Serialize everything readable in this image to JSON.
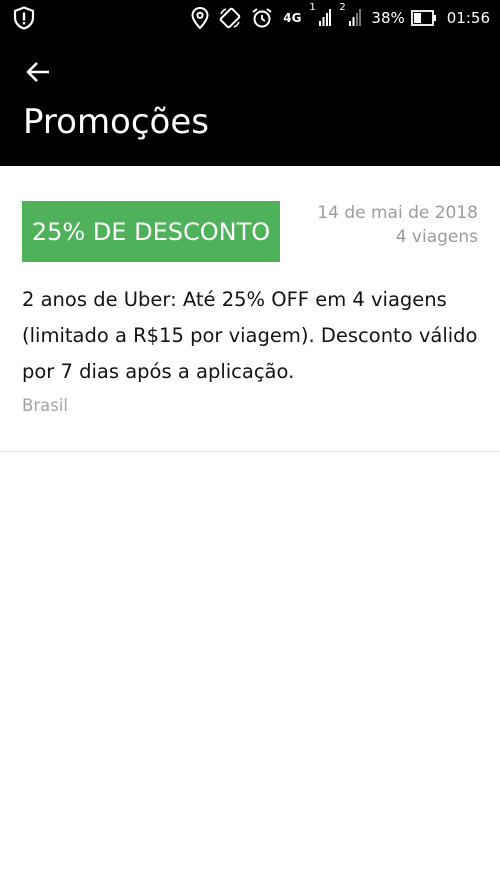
{
  "status_bar": {
    "network": "4G",
    "sim1": "1",
    "sim2": "2",
    "battery": "38%",
    "time": "01:56",
    "icons": [
      "shield-alert-icon",
      "location-icon",
      "rotate-icon",
      "alarm-icon",
      "signal-icon",
      "battery-icon"
    ]
  },
  "header": {
    "title": "Promoções",
    "back_icon": "arrow-back-icon"
  },
  "promotion": {
    "badge": "25% DE DESCONTO",
    "date": "14 de mai de 2018",
    "trips": "4 viagens",
    "description": "2 anos de Uber: Até 25% OFF em 4 viagens (limitado a R$15 por viagem). Desconto válido por 7 dias após a aplicação.",
    "region": "Brasil"
  },
  "colors": {
    "header_bg": "#000000",
    "badge_bg": "#50b15b",
    "meta_text": "#9b9b9b"
  }
}
